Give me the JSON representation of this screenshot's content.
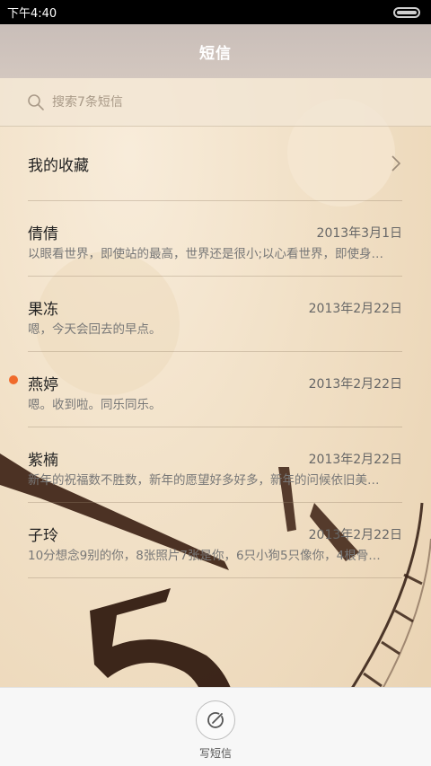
{
  "status_bar": {
    "time": "下午4:40"
  },
  "header": {
    "title": "短信"
  },
  "search": {
    "placeholder": "搜索7条短信",
    "icon": "search-icon"
  },
  "favorites": {
    "label": "我的收藏",
    "icon": "chevron-right-icon"
  },
  "messages": [
    {
      "name": "倩倩",
      "date": "2013年3月1日",
      "preview": "以眼看世界，即使站的最高，世界还是很小;以心看世界，即使身…",
      "unread": false
    },
    {
      "name": "果冻",
      "date": "2013年2月22日",
      "preview": "嗯，今天会回去的早点。",
      "unread": false
    },
    {
      "name": "燕婷",
      "date": "2013年2月22日",
      "preview": "嗯。收到啦。同乐同乐。",
      "unread": true
    },
    {
      "name": "紫楠",
      "date": "2013年2月22日",
      "preview": "新年的祝福数不胜数，新年的愿望好多好多，新年的问候依旧美…",
      "unread": false
    },
    {
      "name": "子玲",
      "date": "2013年2月22日",
      "preview": "10分想念9别的你，8张照片7张是你，6只小狗5只像你，4根骨…",
      "unread": false
    }
  ],
  "bottom_bar": {
    "compose_label": "写短信",
    "compose_icon": "compose-icon"
  },
  "colors": {
    "unread_dot": "#f06a2b",
    "title_bar": "#cbbfb9"
  }
}
